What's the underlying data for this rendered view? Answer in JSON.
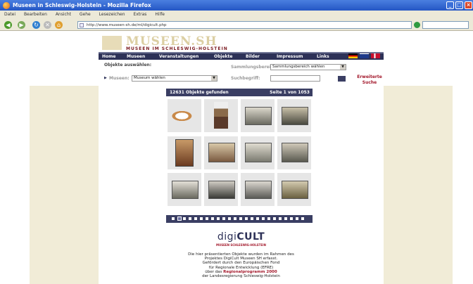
{
  "window": {
    "title": "Museen in Schleswig-Holstein - Mozilla Firefox"
  },
  "menu": [
    "Datei",
    "Bearbeiten",
    "Ansicht",
    "Gehe",
    "Lesezeichen",
    "Extras",
    "Hilfe"
  ],
  "address": {
    "url": "http://www.museen-sh.de/ml/digicult.php"
  },
  "site": {
    "logo_title": "MUSEEN.SH",
    "logo_sub": "MUSEEN IM SCHLESWIG-HOLSTEIN",
    "nav": [
      "Home",
      "Museen",
      "Veranstaltungen",
      "Objekte",
      "Bilder",
      "Impressum",
      "Links"
    ]
  },
  "filter": {
    "heading": "Objekte auswählen:",
    "museum_label": "Museen:",
    "museum_value": "Museum wählen",
    "sammlung_label": "Sammlungsbereich:",
    "sammlung_value": "Sammlungsbereich wählen",
    "suchbegriff_label": "Suchbegriff:",
    "erweiterte_line1": "Erweiterte",
    "erweiterte_line2": "Suche"
  },
  "results": {
    "count_text": "12631 Objekte gefunden",
    "page_text": "Seite 1 von 1053"
  },
  "digicult": {
    "title_light": "digi",
    "title_bold": "CULT",
    "subtitle": "MUSEEN SCHLESWIG-HOLSTEIN",
    "line1": "Die hier präsentierten Objekte wurden im Rahmen des",
    "line2": "Projektes DigiCult Museen SH erfasst.",
    "line3": "Gefördert durch den Europäischen Fond",
    "line4": "für Regionale Entwicklung (EFRE)",
    "line5_pre": "über das",
    "line5_red": "Regionalprogramm 2000",
    "line6": "der Landesregierung Schleswig-Holstein"
  },
  "colors": {
    "nav_bg": "#2d3157",
    "accent_red": "#a3182b",
    "side_bg": "#f1ecd7"
  },
  "icons": [
    "firefox-icon",
    "back-icon",
    "forward-icon",
    "reload-icon",
    "stop-icon",
    "home-icon",
    "flag-de-icon",
    "flag-uk-icon",
    "flag-dk-icon"
  ]
}
